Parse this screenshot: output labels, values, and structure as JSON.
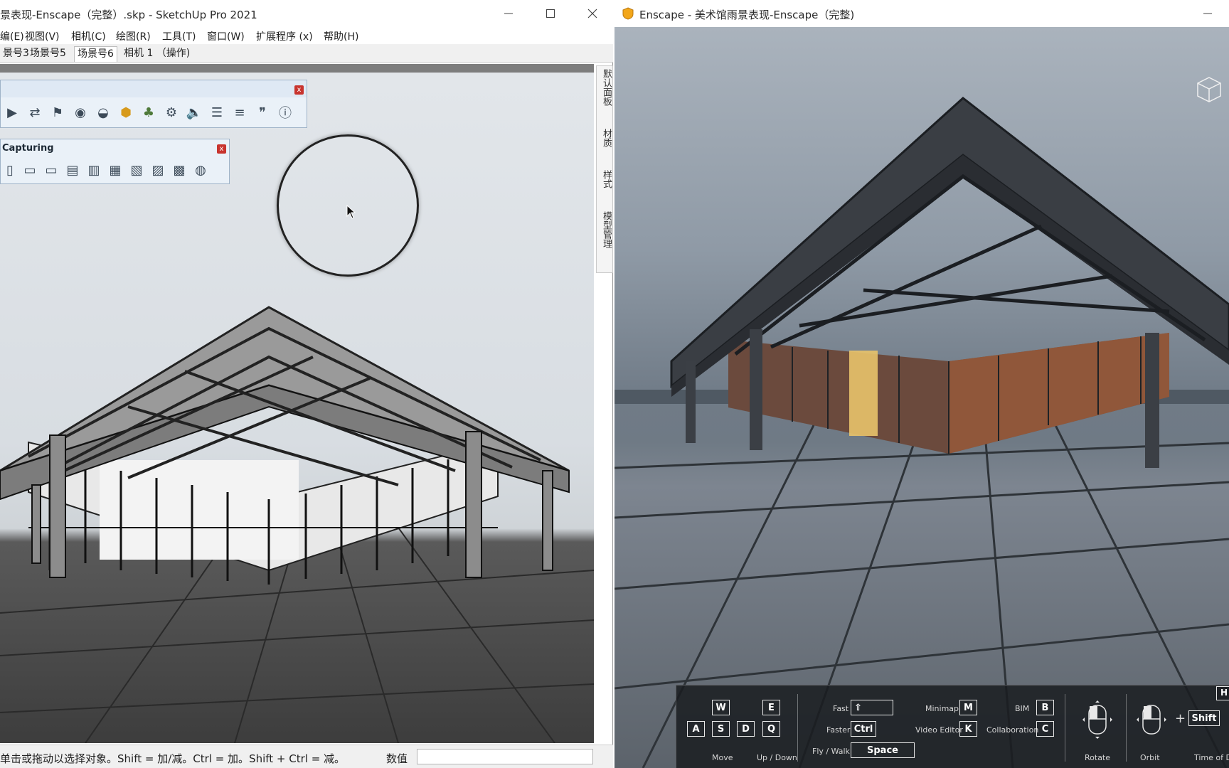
{
  "sketchup": {
    "title": "景表现-Enscape（完整）.skp - SketchUp Pro 2021",
    "menu": [
      "编(E)",
      "视图(V)",
      "相机(C)",
      "绘图(R)",
      "工具(T)",
      "窗口(W)",
      "扩展程序 (x)",
      "帮助(H)"
    ],
    "scene_tabs": [
      "景号3",
      "场景号5",
      "场景号6",
      "相机 1 （操作)"
    ],
    "active_scene_tab": "场景号6",
    "tray_tabs": [
      "默认面板",
      "材质",
      "样式",
      "模型管理"
    ],
    "toolbar_capturing_title": "Capturing",
    "toolbar_close_glyph": "x",
    "status_text": "单击或拖动以选择对象。Shift = 加/减。Ctrl = 加。Shift + Ctrl = 减。",
    "measurements_label": "数值",
    "measurements_value": ""
  },
  "enscape": {
    "title": "Enscape - 美术馆雨景表现-Enscape（完整)",
    "hud": {
      "keys_move": [
        "W",
        "A",
        "S",
        "D"
      ],
      "keys_updown": [
        "E",
        "Q"
      ],
      "label_move": "Move",
      "label_updown": "Up / Down",
      "label_fast": "Fast",
      "key_fast": "⇧",
      "label_faster": "Faster",
      "key_faster": "Ctrl",
      "label_flywalk": "Fly / Walk",
      "key_flywalk": "Space",
      "label_minimap": "Minimap",
      "key_minimap": "M",
      "label_video_editor": "Video Editor",
      "key_video_editor": "K",
      "label_bim": "BIM",
      "key_bim": "B",
      "label_collaboration": "Collaboration",
      "key_collaboration": "C",
      "label_rotate": "Rotate",
      "label_orbit": "Orbit",
      "plus": "+",
      "key_shift": "Shift",
      "label_time_of_day": "Time of Day",
      "key_help": "H"
    }
  },
  "colors": {
    "enscape_accent": "#f2a61a",
    "toolbar_close": "#c8342e"
  }
}
